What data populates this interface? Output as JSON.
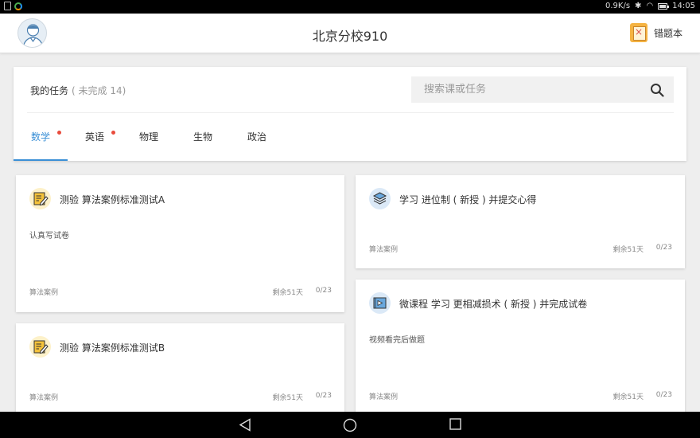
{
  "status_bar": {
    "network_speed": "0.9K/s",
    "time": "14:05"
  },
  "header": {
    "title": "北京分校910",
    "mistake_book_label": "错题本"
  },
  "tasks": {
    "title": "我的任务",
    "count_text": "( 未完成 14)"
  },
  "search": {
    "placeholder": "搜索课或任务"
  },
  "tabs": [
    {
      "label": "数学",
      "active": true,
      "badge": true
    },
    {
      "label": "英语",
      "active": false,
      "badge": true
    },
    {
      "label": "物理",
      "active": false,
      "badge": false
    },
    {
      "label": "生物",
      "active": false,
      "badge": false
    },
    {
      "label": "政治",
      "active": false,
      "badge": false
    }
  ],
  "cards": [
    {
      "icon": "edit-quiz-icon",
      "title": "测验 算法案例标准测试A",
      "desc": "认真写试卷",
      "course": "算法案例",
      "remaining": "剩余51天",
      "progress": "0/23"
    },
    {
      "icon": "layers-study-icon",
      "title": "学习 进位制 ( 新授 ) 并提交心得",
      "desc": "",
      "course": "算法案例",
      "remaining": "剩余51天",
      "progress": "0/23"
    },
    {
      "icon": "video-course-icon",
      "title": "微课程 学习 更相减损术 ( 新授 ) 并完成试卷",
      "desc": "视频看完后做题",
      "course": "算法案例",
      "remaining": "剩余51天",
      "progress": "0/23"
    },
    {
      "icon": "edit-quiz-icon",
      "title": "测验 算法案例标准测试B",
      "desc": "",
      "course": "算法案例",
      "remaining": "剩余51天",
      "progress": "0/23"
    }
  ],
  "colors": {
    "accent": "#3a8fd6",
    "badge": "#e94b3c",
    "background": "#eeeeee"
  }
}
